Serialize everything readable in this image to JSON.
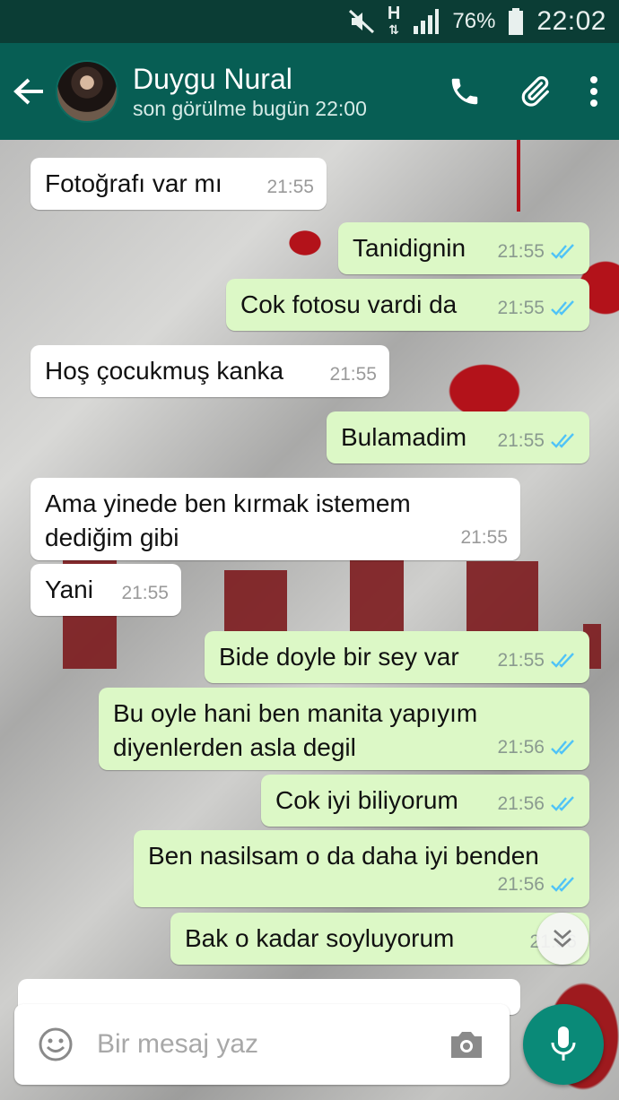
{
  "status_bar": {
    "network_type": "H",
    "battery": "76%",
    "clock": "22:02",
    "icons": [
      "mute-icon",
      "network-h-icon",
      "signal-icon",
      "battery-icon"
    ]
  },
  "header": {
    "contact_name": "Duygu Nural",
    "last_seen": "son görülme bugün 22:00",
    "icons": [
      "back-arrow-icon",
      "phone-icon",
      "paperclip-icon",
      "more-vert-icon"
    ]
  },
  "messages": [
    {
      "dir": "in",
      "text": "Fotoğrafı var mı",
      "time": "21:55"
    },
    {
      "dir": "out",
      "text": "Tanidignin",
      "time": "21:55"
    },
    {
      "dir": "out",
      "text": "Cok fotosu vardi da",
      "time": "21:55"
    },
    {
      "dir": "in",
      "text": "Hoş çocukmuş kanka",
      "time": "21:55"
    },
    {
      "dir": "out",
      "text": "Bulamadim",
      "time": "21:55"
    },
    {
      "dir": "in",
      "text": "Ama yinede ben kırmak istemem dediğim gibi",
      "time": "21:55"
    },
    {
      "dir": "in",
      "text": "Yani",
      "time": "21:55"
    },
    {
      "dir": "out",
      "text": "Bide doyle bir sey var",
      "time": "21:55"
    },
    {
      "dir": "out",
      "text": "Bu oyle hani ben manita yapıyım diyenlerden asla degil",
      "time": "21:56"
    },
    {
      "dir": "out",
      "text": "Cok iyi biliyorum",
      "time": "21:56"
    },
    {
      "dir": "out",
      "text": "Ben nasilsam o da daha iyi benden",
      "time": "21:56"
    },
    {
      "dir": "out",
      "text": "Bak o kadar soyluyorum",
      "time": "21:56"
    }
  ],
  "composer": {
    "placeholder": "Bir mesaj yaz",
    "icons": [
      "emoji-icon",
      "camera-icon",
      "microphone-icon"
    ]
  },
  "colors": {
    "header": "#075e54",
    "status_bar": "#0b3d35",
    "outgoing_bubble": "#dcf8c6",
    "incoming_bubble": "#ffffff",
    "read_ticks": "#4fc3f7",
    "mic_button": "#0a8a78"
  }
}
